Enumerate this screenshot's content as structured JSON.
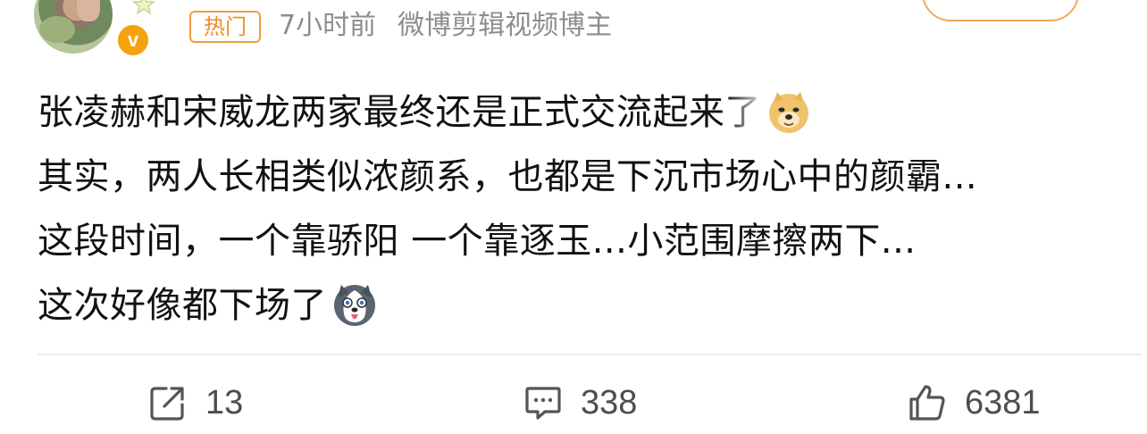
{
  "header": {
    "hot_tag": "热门",
    "time": "7小时前",
    "source": "微博剪辑视频博主",
    "verified_badge": "v"
  },
  "post": {
    "lines": [
      "张凌赫和宋威龙两家最终还是正式交流起来了",
      "其实，两人长相类似浓颜系，也都是下沉市场心中的颜霸...",
      "这段时间，一个靠骄阳 一个靠逐玉...小范围摩擦两下...",
      "这次好像都下场了"
    ],
    "emojis": [
      "doge-emoji",
      "husky-emoji"
    ]
  },
  "actions": {
    "repost_count": "13",
    "comment_count": "338",
    "like_count": "6381"
  },
  "colors": {
    "hot_tag": "#f08c24",
    "meta_text": "#8d8d8d",
    "verified": "#f6a20f",
    "action_text": "#4d4d4d"
  }
}
